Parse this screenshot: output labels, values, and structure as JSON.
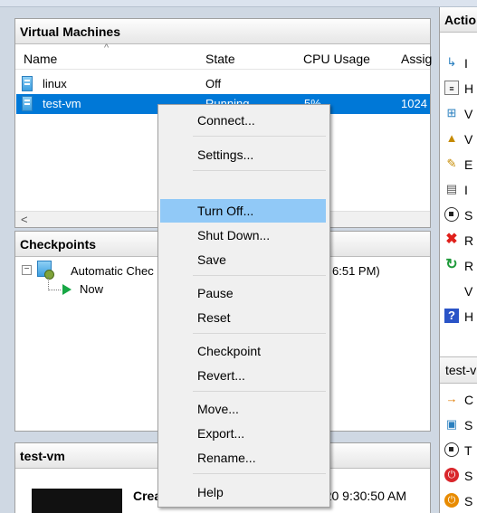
{
  "vm_pane": {
    "title": "Virtual Machines",
    "columns": [
      "Name",
      "State",
      "CPU Usage",
      "Assig"
    ],
    "rows": [
      {
        "name": "linux",
        "state": "Off",
        "cpu": "",
        "assigned": ""
      },
      {
        "name": "test-vm",
        "state": "Running",
        "cpu": "5%",
        "assigned": "1024"
      }
    ]
  },
  "checkpoints_pane": {
    "title": "Checkpoints",
    "tree": [
      {
        "label": "Automatic Chec",
        "suffix": "6:51 PM)"
      },
      {
        "label": "Now"
      }
    ]
  },
  "details_pane": {
    "title": "test-vm",
    "created_label": "Created:",
    "created_value": "8/28/2020 9:30:50 AM"
  },
  "actions_pane": {
    "title": "Actio",
    "items_global": [
      {
        "icon": "import-icon",
        "label": "I"
      },
      {
        "icon": "hyperv-settings-icon",
        "label": "H"
      },
      {
        "icon": "virtual-switch-icon",
        "label": "V"
      },
      {
        "icon": "san-manager-icon",
        "label": "V"
      },
      {
        "icon": "edit-disk-icon",
        "label": "E"
      },
      {
        "icon": "inspect-disk-icon",
        "label": "I"
      },
      {
        "icon": "stop-service-icon",
        "label": "S"
      },
      {
        "icon": "remove-server-icon",
        "label": "R"
      },
      {
        "icon": "refresh-icon",
        "label": "R"
      },
      {
        "icon": "",
        "label": "V"
      },
      {
        "icon": "help-icon",
        "label": "H"
      }
    ],
    "section_vm": "test-v",
    "items_vm": [
      {
        "icon": "connect-icon",
        "label": "C"
      },
      {
        "icon": "settings-icon",
        "label": "S"
      },
      {
        "icon": "turn-off-icon",
        "label": "T"
      },
      {
        "icon": "shut-down-icon",
        "label": "S"
      },
      {
        "icon": "save-icon",
        "label": "S"
      }
    ]
  },
  "context_menu": {
    "items": [
      "Connect...",
      "Settings...",
      "Turn Off...",
      "Shut Down...",
      "Save",
      "Pause",
      "Reset",
      "Checkpoint",
      "Revert...",
      "Move...",
      "Export...",
      "Rename...",
      "Help"
    ],
    "highlighted": "Turn Off..."
  },
  "colors": {
    "selection": "#0078d7",
    "menu_highlight": "#91c9f7",
    "running_green": "#17a745"
  }
}
